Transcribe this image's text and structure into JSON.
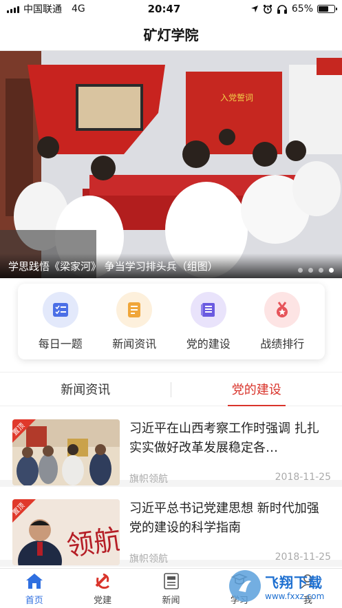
{
  "status_bar": {
    "carrier": "中国联通",
    "network": "4G",
    "time": "20:47",
    "battery": "65%",
    "battery_level": 0.65
  },
  "header": {
    "title": "矿灯学院"
  },
  "banner": {
    "caption": "学思践悟《梁家河》 争当学习排头兵（组图）",
    "slide_count": 4,
    "active_slide": 4,
    "wall_slogan": "入党誓词"
  },
  "quick_menu": [
    {
      "label": "每日一题",
      "icon": "daily-question-icon",
      "bg": "#e3e9fb",
      "fg": "#4b6fe6"
    },
    {
      "label": "新闻资讯",
      "icon": "news-info-icon",
      "bg": "#fdf0dc",
      "fg": "#f0a63a"
    },
    {
      "label": "党的建设",
      "icon": "party-building-icon",
      "bg": "#e9e3fb",
      "fg": "#6a5ae0"
    },
    {
      "label": "战绩排行",
      "icon": "ranking-medal-icon",
      "bg": "#fde4e4",
      "fg": "#e6545a"
    }
  ],
  "tabs": [
    {
      "label": "新闻资讯",
      "active": false
    },
    {
      "label": "党的建设",
      "active": true
    }
  ],
  "news": [
    {
      "title": "习近平在山西考察工作时强调 扎扎实实做好改革发展稳定各…",
      "source": "旗帜领航",
      "date": "2018-11-25",
      "pinned_label": "置顶"
    },
    {
      "title": "习近平总书记党建思想 新时代加强党的建设的科学指南",
      "source": "旗帜领航",
      "date": "2018-11-25",
      "pinned_label": "置顶",
      "thumb_text": "领航"
    }
  ],
  "bottom_nav": [
    {
      "label": "首页",
      "icon": "home-icon",
      "active": true
    },
    {
      "label": "党建",
      "icon": "party-emblem-icon",
      "active": false
    },
    {
      "label": "新闻",
      "icon": "newspaper-icon",
      "active": false
    },
    {
      "label": "学习",
      "icon": "study-icon",
      "active": false
    },
    {
      "label": "我",
      "icon": "profile-icon",
      "active": false
    }
  ],
  "watermark": {
    "main": "飞翔下载",
    "url": "www.fxxz.com"
  },
  "colors": {
    "accent": "#d9342b",
    "nav_active": "#2f6fe0",
    "meta_gray": "#aaaaaa"
  }
}
